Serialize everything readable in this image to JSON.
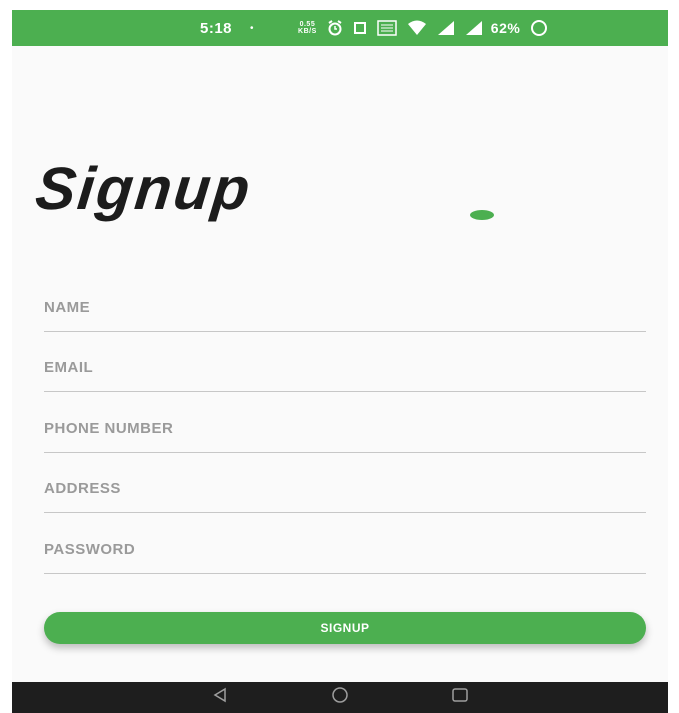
{
  "status_bar": {
    "time": "5:18",
    "dot": "•",
    "speed_value": "0.55",
    "speed_unit": "KB/S",
    "battery_percent": "62%",
    "icons": [
      "alarm-icon",
      "screenshot-icon",
      "volte-icon",
      "wifi-icon",
      "signal-icon",
      "signal-icon",
      "battery-icon"
    ]
  },
  "screen": {
    "title": "Signup"
  },
  "form": {
    "name_placeholder": "NAME",
    "email_placeholder": "EMAIL",
    "phone_placeholder": "PHONE NUMBER",
    "address_placeholder": "ADDRESS",
    "password_placeholder": "PASSWORD",
    "submit_label": "SIGNUP"
  },
  "nav_bar": {
    "icons": [
      "back-icon",
      "home-icon",
      "recents-icon"
    ]
  },
  "colors": {
    "accent": "#4caf50",
    "title": "#1c1c1c",
    "placeholder": "#9a9a9a",
    "divider": "#c7c7c7",
    "nav_bar": "#1e1e1e"
  }
}
